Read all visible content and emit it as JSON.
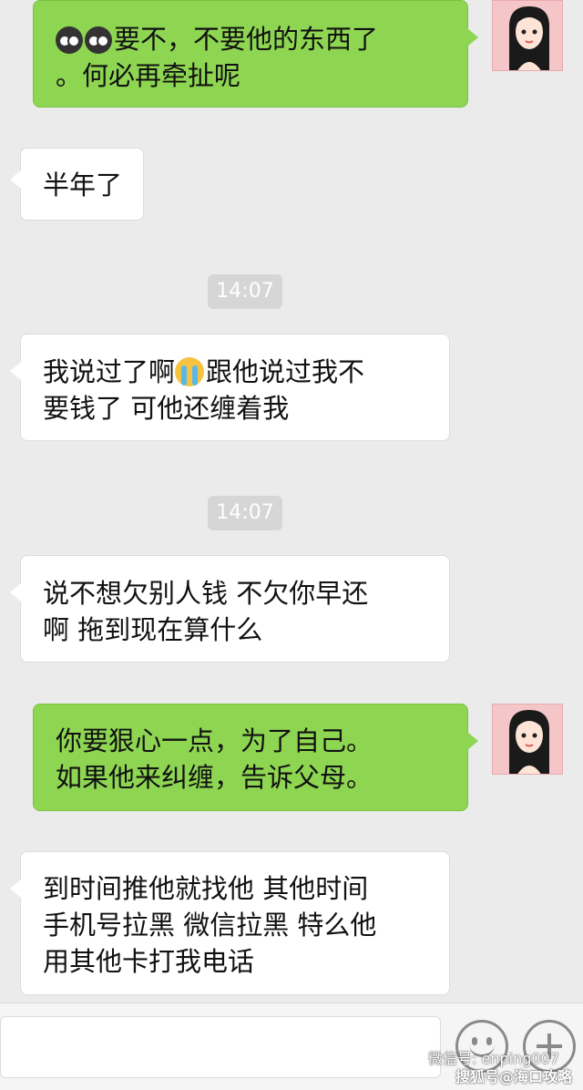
{
  "messages": [
    {
      "side": "sent",
      "emojis": [
        "owl-emoji",
        "owl-emoji"
      ],
      "lines": [
        "要不，不要他的东西了",
        "。何必再牵扯呢"
      ]
    },
    {
      "side": "recv",
      "lines": [
        "半年了"
      ]
    },
    {
      "time": "14:07"
    },
    {
      "side": "recv",
      "lines": [
        "我说过了啊",
        "跟他说过我不",
        "要钱了 可他还缠着我"
      ]
    },
    {
      "time": "14:07"
    },
    {
      "side": "recv",
      "lines": [
        "说不想欠别人钱 不欠你早还",
        "啊 拖到现在算什么"
      ]
    },
    {
      "side": "sent",
      "lines": [
        "你要狠心一点，为了自己。",
        "如果他来纠缠，告诉父母。"
      ]
    },
    {
      "side": "recv",
      "lines": [
        "到时间推他就找他 其他时间",
        "手机号拉黑 微信拉黑 特么他",
        "用其他卡打我电话"
      ]
    }
  ],
  "input_bar": {
    "emoji_button_icon": "smiley-icon",
    "more_button_icon": "plus-icon"
  },
  "watermark": {
    "line1": "微信号: enping007",
    "line2": "搜狐号@海口攻略"
  },
  "colors": {
    "background": "#ebebeb",
    "sent_bubble": "#8ed652",
    "received_bubble": "#ffffff",
    "timestamp_bg": "#d6d6d6"
  }
}
